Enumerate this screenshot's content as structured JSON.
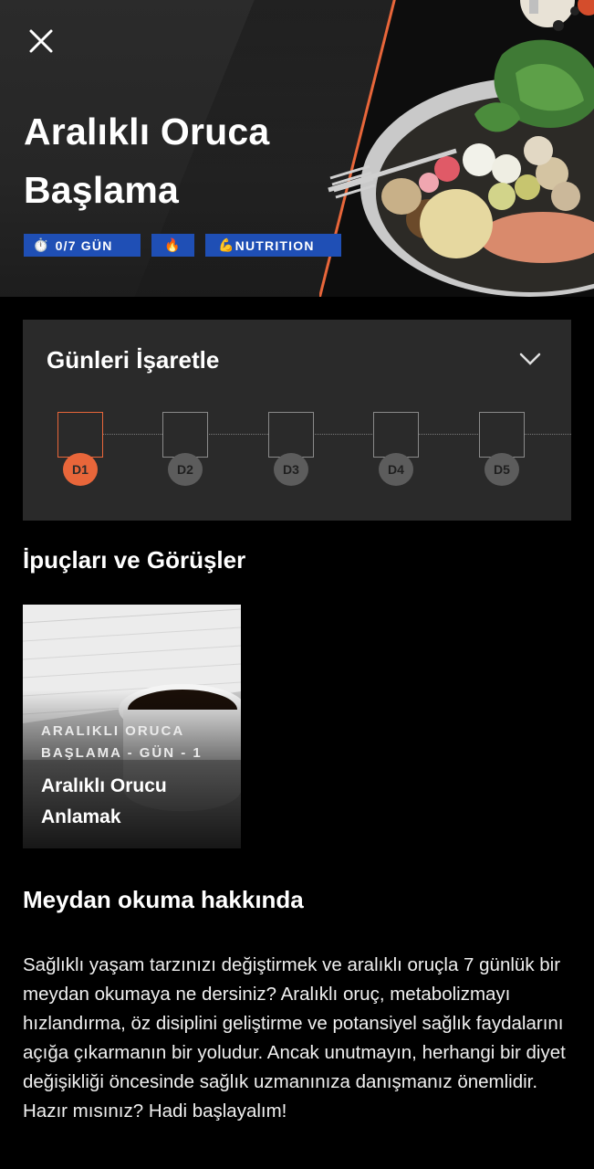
{
  "header": {
    "close_icon": "close-icon",
    "title": "Aralıklı Oruca Başlama",
    "badges": [
      {
        "icon": "⏱️",
        "text": "0/7 GÜN"
      },
      {
        "icon": "🔥",
        "text": ""
      },
      {
        "icon": "💪",
        "text": "NUTRITION"
      }
    ]
  },
  "days": {
    "title": "Günleri İşaretle",
    "items": [
      "D1",
      "D2",
      "D3",
      "D4",
      "D5"
    ],
    "active_index": 0
  },
  "tips": {
    "section_title": "İpuçları ve Görüşler",
    "card": {
      "subtitle": "ARALIKLI ORUCA BAŞLAMA - GÜN - 1",
      "title": "Aralıklı Orucu Anlamak"
    }
  },
  "about": {
    "title": "Meydan okuma hakkında",
    "text": "Sağlıklı yaşam tarzınızı değiştirmek ve aralıklı oruçla 7 günlük bir meydan okumaya ne dersiniz? Aralıklı oruç, metabolizmayı hızlandırma, öz disiplini geliştirme ve potansiyel sağlık faydalarını açığa çıkarmanın bir yoludur. Ancak unutmayın, herhangi bir diyet değişikliği öncesinde sağlık uzmanınıza danışmanız önemlidir. Hazır mısınız? Hadi başlayalım!"
  },
  "colors": {
    "accent": "#e8663a",
    "badge_blue": "#1f4fb5",
    "card_bg": "#2a2a2a"
  }
}
